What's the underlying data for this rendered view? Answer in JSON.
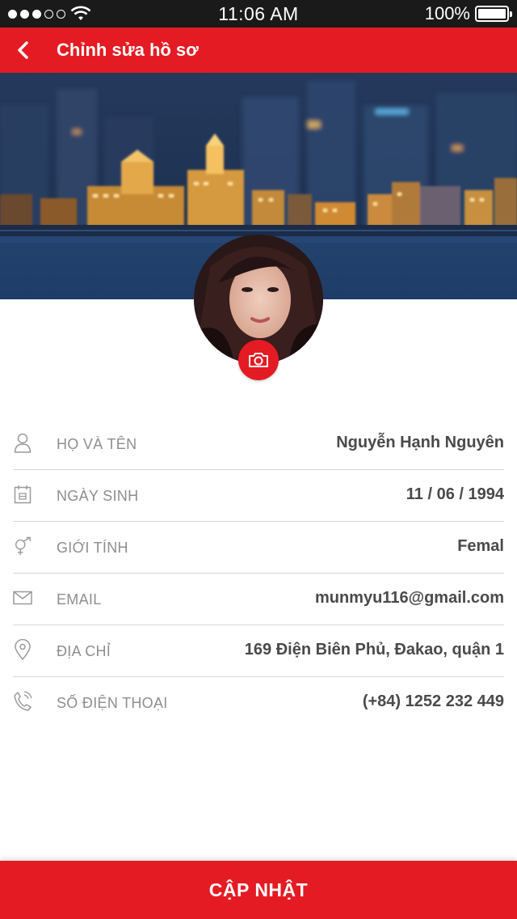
{
  "status_bar": {
    "time": "11:06 AM",
    "battery_text": "100%",
    "battery_level": 1.0,
    "signal_bars_filled": 3,
    "signal_bars_total": 5
  },
  "header": {
    "back_icon": "chevron-left-icon",
    "title": "Chỉnh sửa hồ sơ"
  },
  "profile": {
    "camera_icon": "camera-icon"
  },
  "fields": [
    {
      "icon": "person-icon",
      "label": "HỌ VÀ TÊN",
      "value": "Nguyễn Hạnh Nguyên"
    },
    {
      "icon": "calendar-icon",
      "label": "NGÀY SINH",
      "value": "11 / 06 / 1994"
    },
    {
      "icon": "gender-icon",
      "label": "GIỚI TÍNH",
      "value": "Femal"
    },
    {
      "icon": "envelope-icon",
      "label": "EMAIL",
      "value": "munmyu116@gmail.com"
    },
    {
      "icon": "location-pin-icon",
      "label": "ĐỊA CHỈ",
      "value": "169 Điện Biên Phủ, Đakao, quận 1"
    },
    {
      "icon": "phone-icon",
      "label": "SỐ ĐIỆN THOẠI",
      "value": "(+84) 1252 232 449"
    }
  ],
  "actions": {
    "update_label": "CẬP NHẬT"
  },
  "colors": {
    "primary": "#e41b23",
    "status_bar": "#1a1a1a",
    "label": "#8e8e8e",
    "value": "#4a4a4a",
    "divider": "#d6d6d6"
  }
}
